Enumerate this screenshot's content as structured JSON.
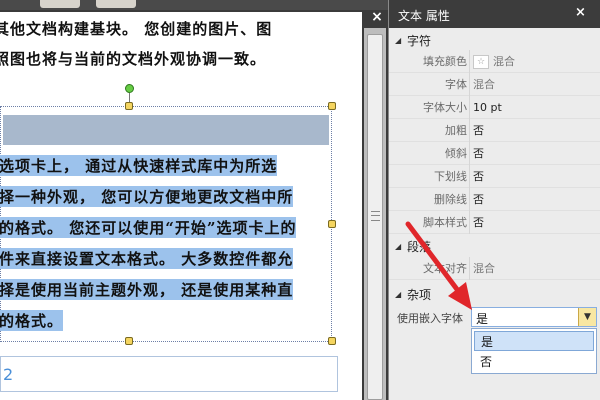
{
  "document": {
    "lines_top": [
      "其他文档构建基块。 您创建的图片、图",
      "照图也将与当前的文档外观协调一致。"
    ],
    "lines_body": [
      "选项卡上， 通过从快速样式库中为所选",
      "择一种外观， 您可以方便地更改文档中所",
      "的格式。 您还可以使用“开始”选项卡上的",
      "件来直接设置文本格式。 大多数控件都允",
      "择是使用当前主题外观， 还是使用某种直",
      "的格式。"
    ],
    "bottom_digit": "2",
    "close_glyph": "×"
  },
  "panel": {
    "title": "文本 属性",
    "close_glyph": "×",
    "sections": {
      "font": "字符",
      "paragraph": "段落",
      "misc": "杂项"
    },
    "font_props": [
      {
        "name": "填充颜色",
        "value": "混合",
        "swatch": "☆"
      },
      {
        "name": "字体",
        "value": "混合"
      },
      {
        "name": "字体大小",
        "value": "10 pt"
      },
      {
        "name": "加粗",
        "value": "否"
      },
      {
        "name": "倾斜",
        "value": "否"
      },
      {
        "name": "下划线",
        "value": "否"
      },
      {
        "name": "删除线",
        "value": "否"
      },
      {
        "name": "脚本样式",
        "value": "否"
      }
    ],
    "paragraph_props": [
      {
        "name": "文本对齐",
        "value": "混合"
      }
    ],
    "embed_font": {
      "name": "使用嵌入字体",
      "value": "是",
      "options": [
        "是",
        "否"
      ]
    }
  },
  "colors": {
    "highlight": "#9cc2ec",
    "annotation_arrow": "#e0262a",
    "dropdown_accent": "#f8e7a2"
  }
}
